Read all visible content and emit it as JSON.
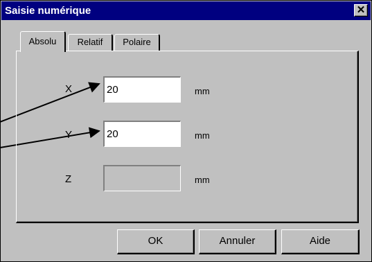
{
  "dialog": {
    "title": "Saisie numérique",
    "close_glyph": "✕"
  },
  "tabs": [
    {
      "label": "Absolu",
      "active": true
    },
    {
      "label": "Relatif",
      "active": false
    },
    {
      "label": "Polaire",
      "active": false
    }
  ],
  "fields": {
    "x": {
      "label": "X",
      "value": "20",
      "unit": "mm",
      "enabled": true
    },
    "y": {
      "label": "Y",
      "value": "20",
      "unit": "mm",
      "enabled": true
    },
    "z": {
      "label": "Z",
      "value": "",
      "unit": "mm",
      "enabled": false
    }
  },
  "buttons": {
    "ok": "OK",
    "cancel": "Annuler",
    "help": "Aide"
  },
  "annotations": {
    "arrow_color": "#000000",
    "arrow_count": 2
  }
}
